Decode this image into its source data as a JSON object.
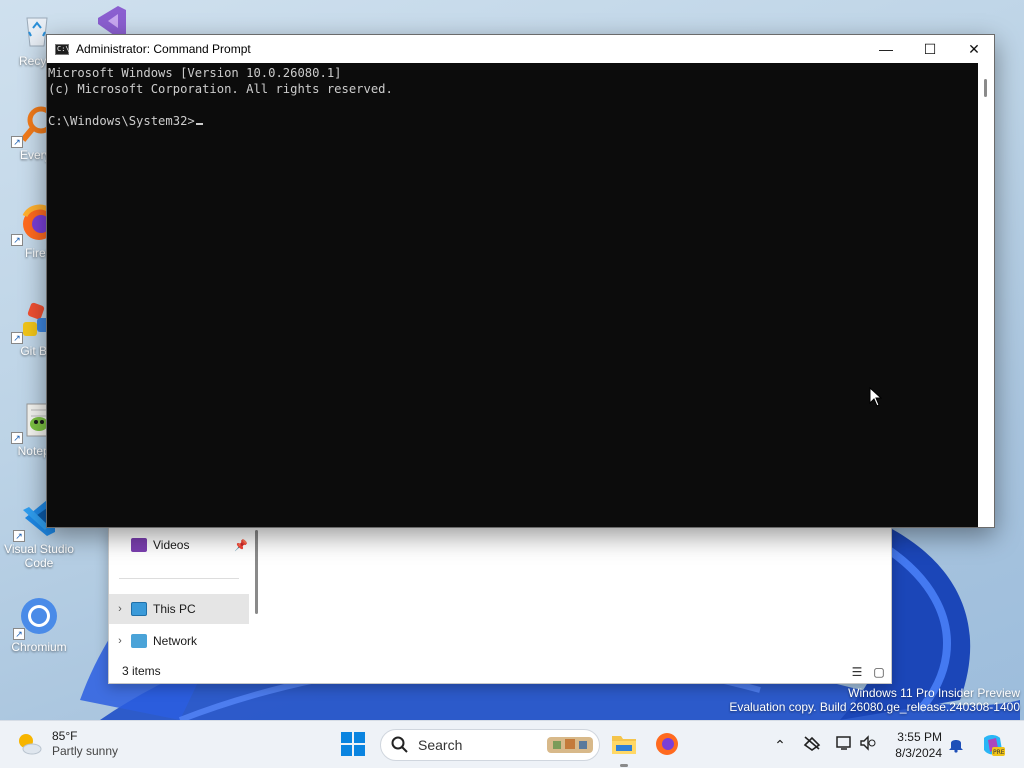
{
  "desktop": {
    "icons": [
      {
        "label": "Recycl",
        "icon": "recycle-bin-icon"
      },
      {
        "label": "Everyt",
        "icon": "everything-search-icon"
      },
      {
        "label": "Firef",
        "icon": "firefox-icon"
      },
      {
        "label": "Git Ba",
        "icon": "git-bash-icon"
      },
      {
        "label": "Notepa",
        "icon": "notepad-plus-icon"
      },
      {
        "label": "Visual Studio\nCode",
        "icon": "vscode-icon"
      },
      {
        "label": "Chromium",
        "icon": "chromium-icon"
      }
    ]
  },
  "cmd": {
    "title": "Administrator: Command Prompt",
    "app_icon_text": "C:\\",
    "lines": [
      "Microsoft Windows [Version 10.0.26080.1]",
      "(c) Microsoft Corporation. All rights reserved.",
      "",
      "C:\\Windows\\System32>"
    ],
    "controls": {
      "minimize": "—",
      "maximize": "☐",
      "close": "✕"
    }
  },
  "explorer": {
    "nav_items": [
      {
        "label": "Videos",
        "pinned": true
      },
      {
        "label": "This PC",
        "selected": true
      },
      {
        "label": "Network"
      }
    ],
    "status": "3 items"
  },
  "watermark": {
    "line1": "Windows 11 Pro Insider Preview",
    "line2": "Evaluation copy. Build 26080.ge_release.240308-1400"
  },
  "taskbar": {
    "weather_temp": "85°F",
    "weather_cond": "Partly sunny",
    "search_placeholder": "Search",
    "time": "3:55 PM",
    "date": "8/3/2024"
  },
  "colors": {
    "console_bg": "#0c0c0c",
    "console_fg": "#cccccc",
    "taskbar_bg": "#eef2f7",
    "accent": "#0078d4"
  }
}
